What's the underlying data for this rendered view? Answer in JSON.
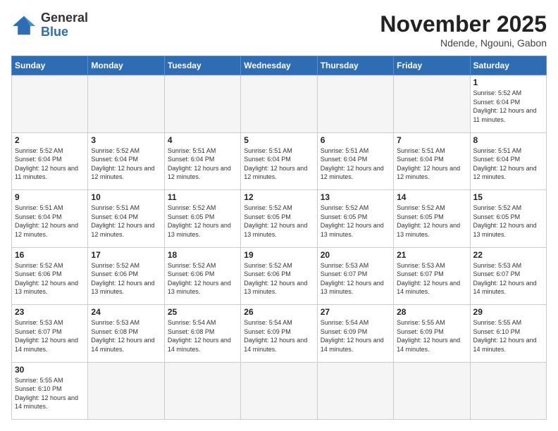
{
  "logo": {
    "general": "General",
    "blue": "Blue"
  },
  "header": {
    "month": "November 2025",
    "location": "Ndende, Ngouni, Gabon"
  },
  "weekdays": [
    "Sunday",
    "Monday",
    "Tuesday",
    "Wednesday",
    "Thursday",
    "Friday",
    "Saturday"
  ],
  "days": {
    "1": {
      "sunrise": "5:52 AM",
      "sunset": "6:04 PM",
      "daylight": "12 hours and 11 minutes."
    },
    "2": {
      "sunrise": "5:52 AM",
      "sunset": "6:04 PM",
      "daylight": "12 hours and 11 minutes."
    },
    "3": {
      "sunrise": "5:52 AM",
      "sunset": "6:04 PM",
      "daylight": "12 hours and 12 minutes."
    },
    "4": {
      "sunrise": "5:51 AM",
      "sunset": "6:04 PM",
      "daylight": "12 hours and 12 minutes."
    },
    "5": {
      "sunrise": "5:51 AM",
      "sunset": "6:04 PM",
      "daylight": "12 hours and 12 minutes."
    },
    "6": {
      "sunrise": "5:51 AM",
      "sunset": "6:04 PM",
      "daylight": "12 hours and 12 minutes."
    },
    "7": {
      "sunrise": "5:51 AM",
      "sunset": "6:04 PM",
      "daylight": "12 hours and 12 minutes."
    },
    "8": {
      "sunrise": "5:51 AM",
      "sunset": "6:04 PM",
      "daylight": "12 hours and 12 minutes."
    },
    "9": {
      "sunrise": "5:51 AM",
      "sunset": "6:04 PM",
      "daylight": "12 hours and 12 minutes."
    },
    "10": {
      "sunrise": "5:51 AM",
      "sunset": "6:04 PM",
      "daylight": "12 hours and 12 minutes."
    },
    "11": {
      "sunrise": "5:52 AM",
      "sunset": "6:05 PM",
      "daylight": "12 hours and 13 minutes."
    },
    "12": {
      "sunrise": "5:52 AM",
      "sunset": "6:05 PM",
      "daylight": "12 hours and 13 minutes."
    },
    "13": {
      "sunrise": "5:52 AM",
      "sunset": "6:05 PM",
      "daylight": "12 hours and 13 minutes."
    },
    "14": {
      "sunrise": "5:52 AM",
      "sunset": "6:05 PM",
      "daylight": "12 hours and 13 minutes."
    },
    "15": {
      "sunrise": "5:52 AM",
      "sunset": "6:05 PM",
      "daylight": "12 hours and 13 minutes."
    },
    "16": {
      "sunrise": "5:52 AM",
      "sunset": "6:06 PM",
      "daylight": "12 hours and 13 minutes."
    },
    "17": {
      "sunrise": "5:52 AM",
      "sunset": "6:06 PM",
      "daylight": "12 hours and 13 minutes."
    },
    "18": {
      "sunrise": "5:52 AM",
      "sunset": "6:06 PM",
      "daylight": "12 hours and 13 minutes."
    },
    "19": {
      "sunrise": "5:52 AM",
      "sunset": "6:06 PM",
      "daylight": "12 hours and 13 minutes."
    },
    "20": {
      "sunrise": "5:53 AM",
      "sunset": "6:07 PM",
      "daylight": "12 hours and 13 minutes."
    },
    "21": {
      "sunrise": "5:53 AM",
      "sunset": "6:07 PM",
      "daylight": "12 hours and 14 minutes."
    },
    "22": {
      "sunrise": "5:53 AM",
      "sunset": "6:07 PM",
      "daylight": "12 hours and 14 minutes."
    },
    "23": {
      "sunrise": "5:53 AM",
      "sunset": "6:07 PM",
      "daylight": "12 hours and 14 minutes."
    },
    "24": {
      "sunrise": "5:53 AM",
      "sunset": "6:08 PM",
      "daylight": "12 hours and 14 minutes."
    },
    "25": {
      "sunrise": "5:54 AM",
      "sunset": "6:08 PM",
      "daylight": "12 hours and 14 minutes."
    },
    "26": {
      "sunrise": "5:54 AM",
      "sunset": "6:09 PM",
      "daylight": "12 hours and 14 minutes."
    },
    "27": {
      "sunrise": "5:54 AM",
      "sunset": "6:09 PM",
      "daylight": "12 hours and 14 minutes."
    },
    "28": {
      "sunrise": "5:55 AM",
      "sunset": "6:09 PM",
      "daylight": "12 hours and 14 minutes."
    },
    "29": {
      "sunrise": "5:55 AM",
      "sunset": "6:10 PM",
      "daylight": "12 hours and 14 minutes."
    },
    "30": {
      "sunrise": "5:55 AM",
      "sunset": "6:10 PM",
      "daylight": "12 hours and 14 minutes."
    }
  }
}
